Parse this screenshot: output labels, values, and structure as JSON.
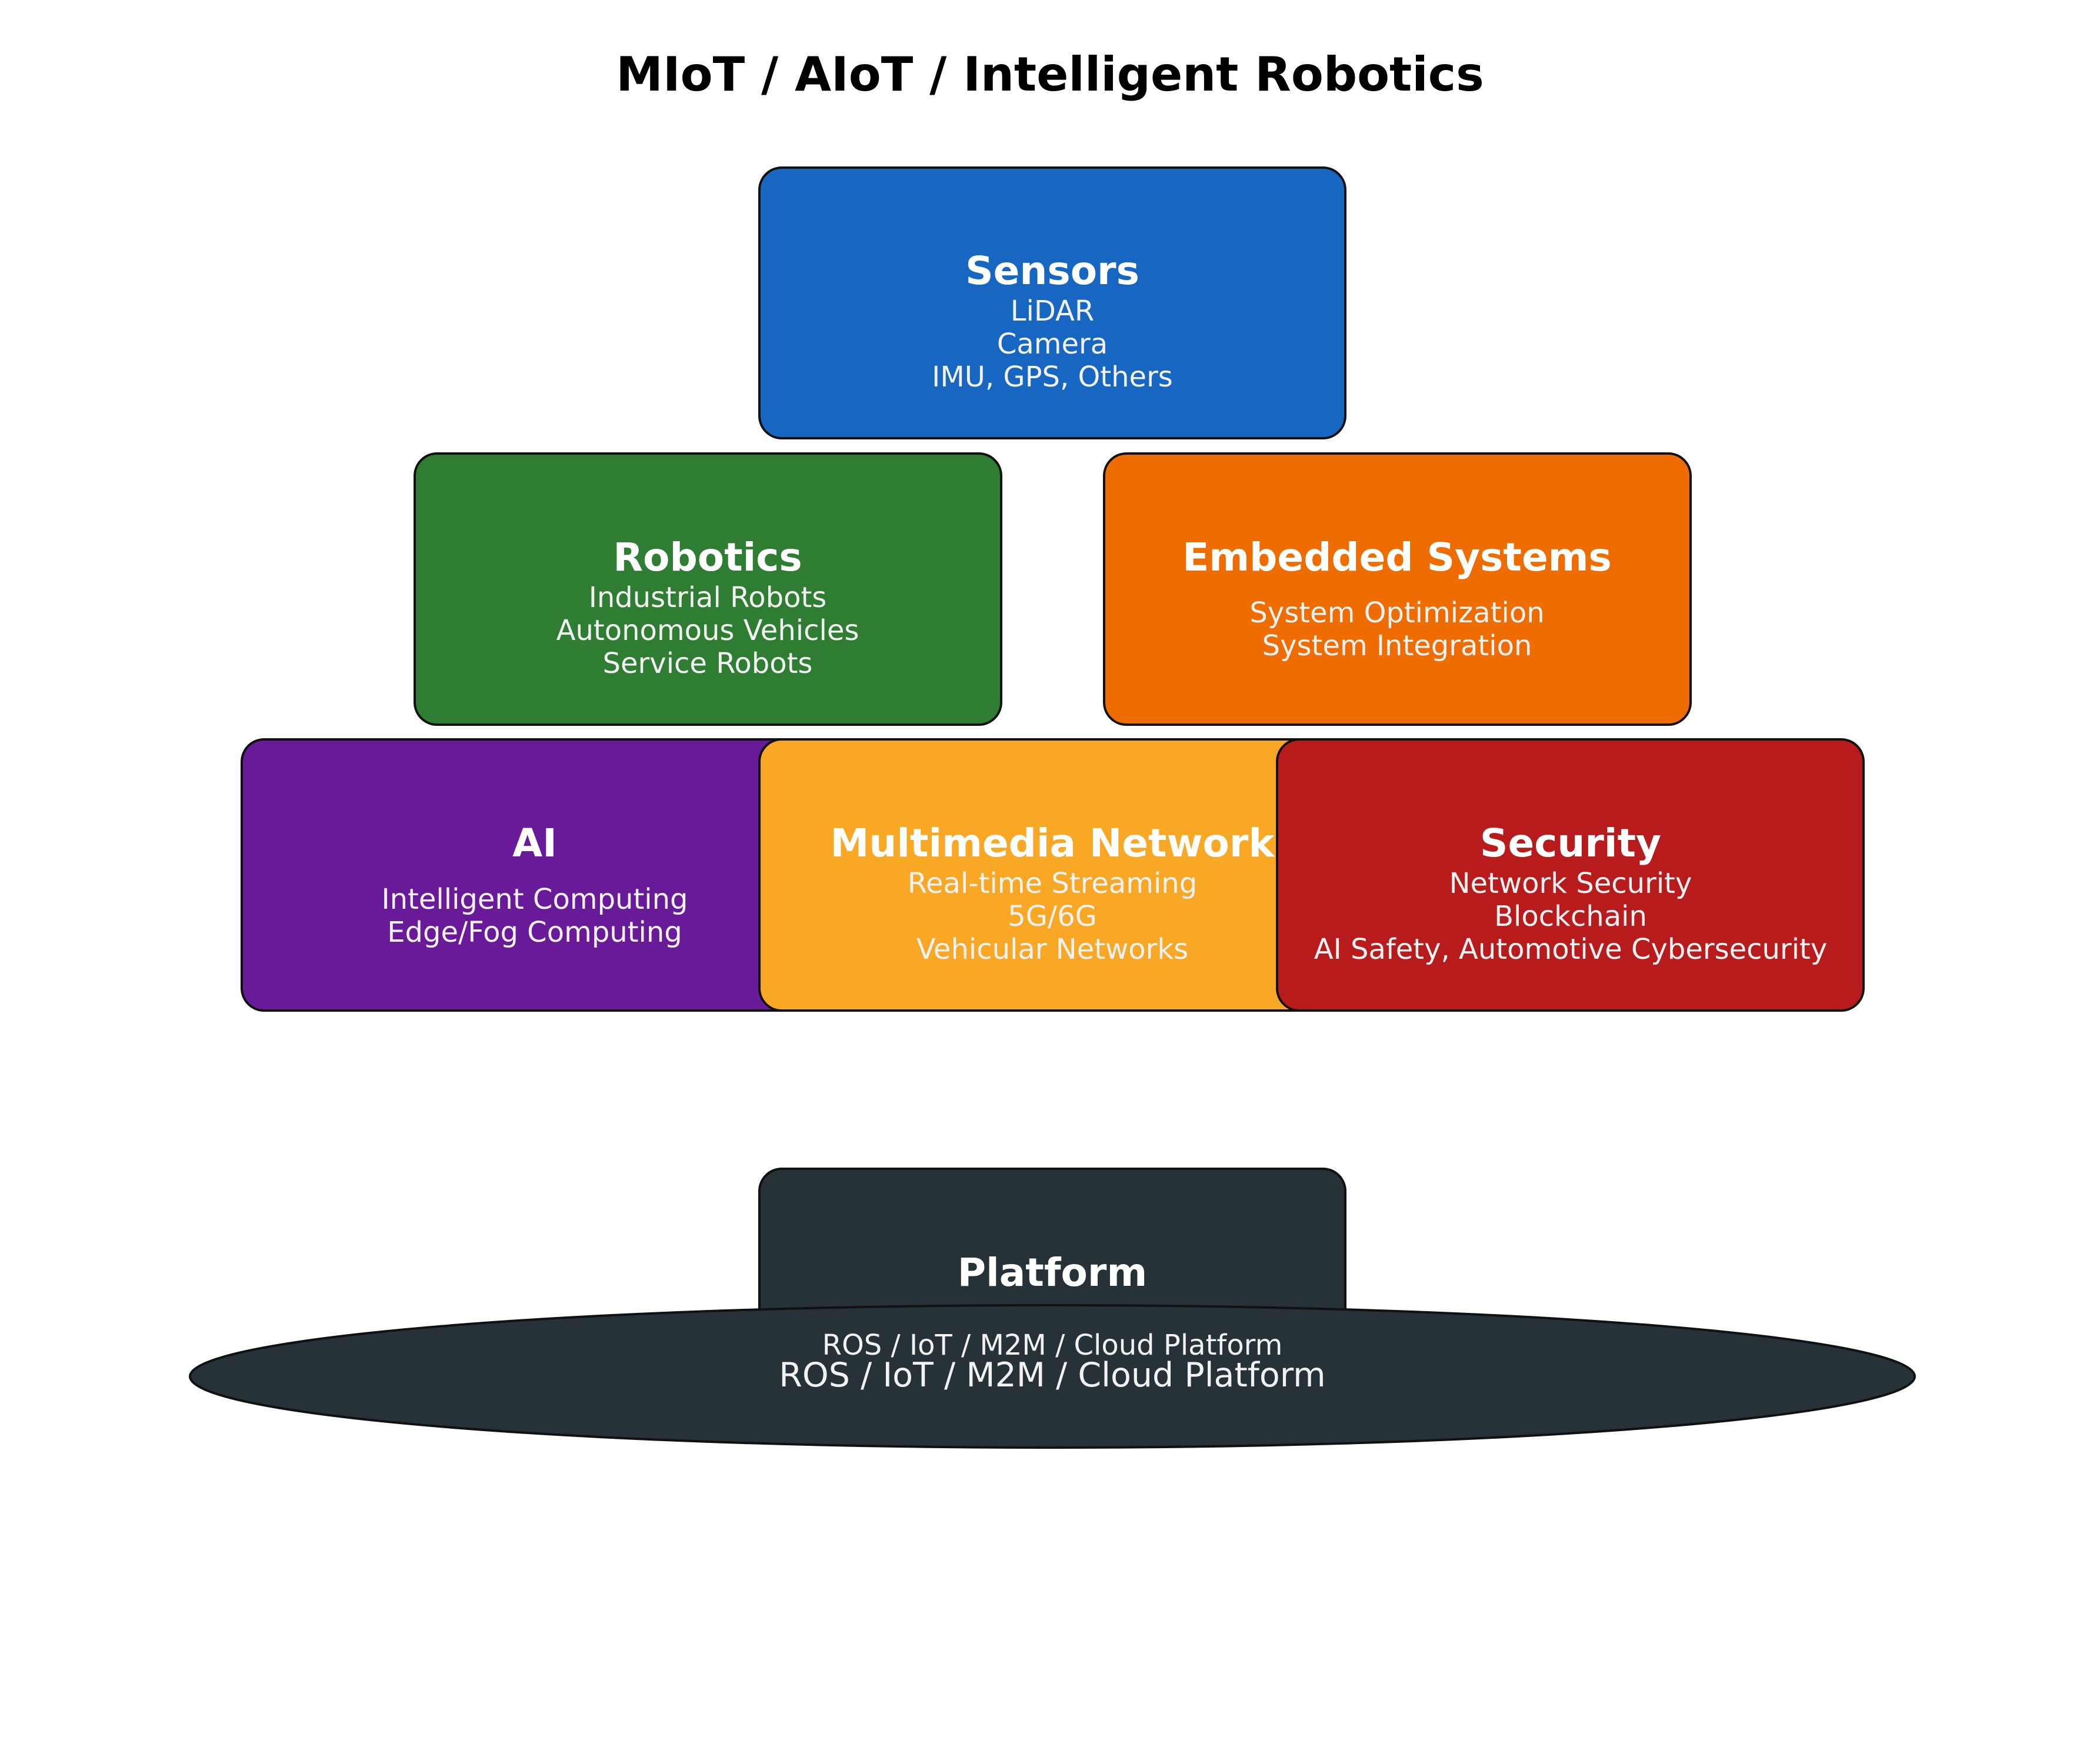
{
  "title": "MIoT / AIoT / Intelligent Robotics",
  "colors": {
    "sensors": "#1766c1",
    "robotics": "#2f7d32",
    "embedded": "#ef6c01",
    "ai": "#691a99",
    "multimedia": "#f8a825",
    "security": "#b71b1c",
    "platform": "#263237",
    "border": "#111111"
  },
  "boxes": {
    "sensors": {
      "title": "Sensors",
      "lines": [
        "LiDAR",
        "Camera",
        "IMU, GPS, Others"
      ]
    },
    "robotics": {
      "title": "Robotics",
      "lines": [
        "Industrial Robots",
        "Autonomous Vehicles",
        "Service Robots"
      ]
    },
    "embedded": {
      "title": "Embedded Systems",
      "lines": [
        "System Optimization",
        "System Integration"
      ]
    },
    "ai": {
      "title": "AI",
      "lines": [
        "Intelligent Computing",
        "Edge/Fog Computing"
      ]
    },
    "multimedia": {
      "title": "Multimedia Network",
      "lines": [
        "Real-time Streaming",
        "5G/6G",
        "Vehicular Networks"
      ]
    },
    "security": {
      "title": "Security",
      "lines": [
        "Network Security",
        "Blockchain",
        "AI Safety, Automotive Cybersecurity"
      ]
    },
    "platform": {
      "title": "Platform",
      "lines": [
        "ROS / IoT / M2M / Cloud Platform"
      ]
    }
  },
  "platform_base": {
    "label": "ROS / IoT / M2M / Cloud Platform"
  }
}
